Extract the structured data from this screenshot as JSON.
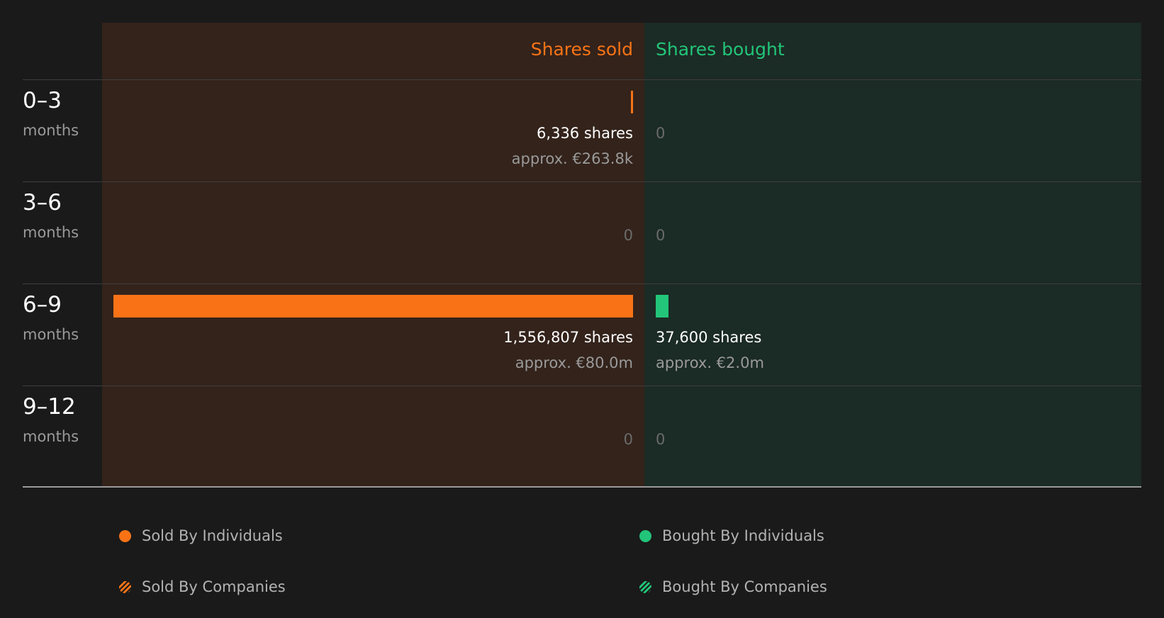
{
  "colors": {
    "sold": "#f97316",
    "bought": "#22c579",
    "sold_panel": "#33231b",
    "bought_panel": "#1b2b25",
    "background": "#1a1a1a"
  },
  "chart_data": {
    "type": "bar",
    "orientation": "horizontal-diverging",
    "headers": {
      "sold": "Shares sold",
      "bought": "Shares bought"
    },
    "categories": [
      {
        "range": "0–3",
        "unit": "months"
      },
      {
        "range": "3–6",
        "unit": "months"
      },
      {
        "range": "6–9",
        "unit": "months"
      },
      {
        "range": "9–12",
        "unit": "months"
      }
    ],
    "series": [
      {
        "name": "Shares sold",
        "values": [
          6336,
          0,
          1556807,
          0
        ],
        "share_labels": [
          "6,336 shares",
          "0",
          "1,556,807 shares",
          "0"
        ],
        "approx_labels": [
          "approx. €263.8k",
          "",
          "approx. €80.0m",
          ""
        ]
      },
      {
        "name": "Shares bought",
        "values": [
          0,
          0,
          37600,
          0
        ],
        "share_labels": [
          "0",
          "0",
          "37,600 shares",
          "0"
        ],
        "approx_labels": [
          "",
          "",
          "approx. €2.0m",
          ""
        ]
      }
    ],
    "xlim": [
      0,
      1556807
    ],
    "legend": {
      "position": "bottom",
      "items": [
        {
          "label": "Sold By Individuals",
          "swatch": "dot-icon",
          "color": "#f97316"
        },
        {
          "label": "Bought By Individuals",
          "swatch": "dot-icon",
          "color": "#22c579"
        },
        {
          "label": "Sold By Companies",
          "swatch": "hatched-dot-icon",
          "color": "#f97316"
        },
        {
          "label": "Bought By Companies",
          "swatch": "hatched-dot-icon",
          "color": "#22c579"
        }
      ]
    }
  }
}
